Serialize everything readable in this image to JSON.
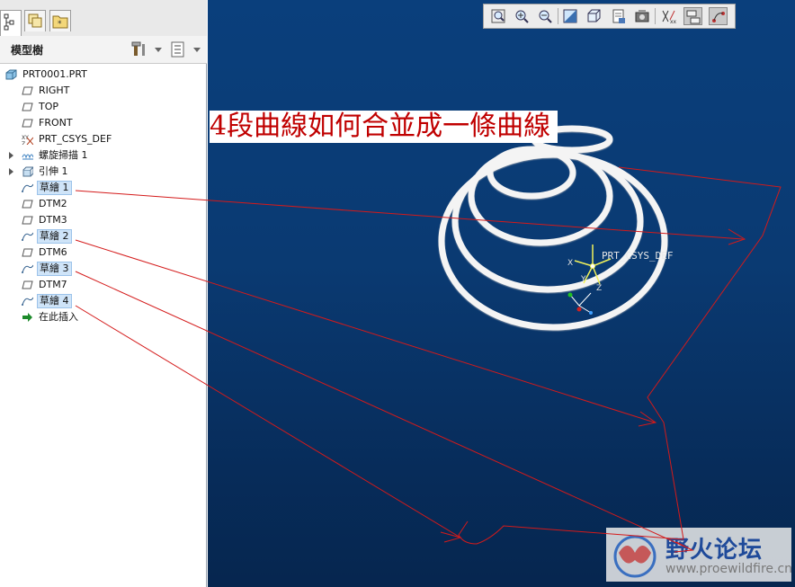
{
  "annotation": "4段曲線如何合並成一條曲線",
  "panel": {
    "title": "模型樹",
    "tabs": [
      "model-tree-tab-icon",
      "layers-tab-icon",
      "favorites-tab-icon"
    ]
  },
  "tree": {
    "items": [
      {
        "label": "PRT0001.PRT",
        "icon": "part-icon"
      },
      {
        "label": "RIGHT",
        "icon": "datum-plane-icon"
      },
      {
        "label": "TOP",
        "icon": "datum-plane-icon"
      },
      {
        "label": "FRONT",
        "icon": "datum-plane-icon"
      },
      {
        "label": "PRT_CSYS_DEF",
        "icon": "csys-icon"
      },
      {
        "label": "螺旋掃描 1",
        "icon": "helical-sweep-icon"
      },
      {
        "label": "引伸 1",
        "icon": "extrude-icon"
      },
      {
        "label": "草繪 1",
        "icon": "sketch-icon"
      },
      {
        "label": "DTM2",
        "icon": "datum-plane-icon"
      },
      {
        "label": "DTM3",
        "icon": "datum-plane-icon"
      },
      {
        "label": "草繪 2",
        "icon": "sketch-icon"
      },
      {
        "label": "DTM6",
        "icon": "datum-plane-icon"
      },
      {
        "label": "草繪 3",
        "icon": "sketch-icon"
      },
      {
        "label": "DTM7",
        "icon": "datum-plane-icon"
      },
      {
        "label": "草繪 4",
        "icon": "sketch-icon"
      },
      {
        "label": "在此插入",
        "icon": "insert-here-arrow-icon"
      }
    ]
  },
  "toolbar": {
    "buttons": [
      "zoom-fit-icon",
      "zoom-in-icon",
      "zoom-out-icon",
      "repaint-icon",
      "view-orient-icon",
      "saved-views-icon",
      "render-icon",
      "datum-display-icon",
      "layer-display-icon",
      "sketch-display-icon"
    ]
  },
  "viewport": {
    "csys_label": "PRT_CSYS_DEF",
    "axis_x": "X",
    "axis_y": "Y",
    "axis_z": "Z"
  },
  "watermark": {
    "title": "野火论坛",
    "url": "www.proewildfire.cn"
  },
  "colors": {
    "annotation_text": "#c00000",
    "arrow_lines": "#d01010",
    "selection": "#cfe4f8",
    "viewport_bg": "#0a3f7c"
  }
}
